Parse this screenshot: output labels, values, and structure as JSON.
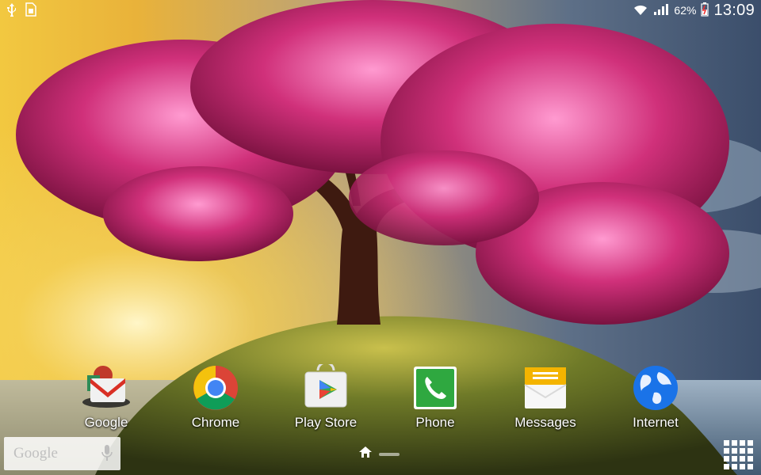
{
  "status_bar": {
    "time": "13:09",
    "battery_percent": "62%",
    "icons": [
      "usb-icon",
      "sim-card-icon",
      "wifi-icon",
      "signal-icon",
      "battery-icon"
    ]
  },
  "apps": [
    {
      "name": "google-folder",
      "label": "Google"
    },
    {
      "name": "chrome",
      "label": "Chrome"
    },
    {
      "name": "play-store",
      "label": "Play Store"
    },
    {
      "name": "phone",
      "label": "Phone"
    },
    {
      "name": "messages",
      "label": "Messages"
    },
    {
      "name": "internet",
      "label": "Internet"
    }
  ],
  "search_widget": {
    "logo_text": "Google"
  },
  "page_indicator": {
    "current_page": 1,
    "pages": 2
  },
  "colors": {
    "tree_pink": "#d0307a",
    "sky_left": "#f2c840",
    "sky_right": "#3b4e6b",
    "grass": "#5a6b22"
  }
}
